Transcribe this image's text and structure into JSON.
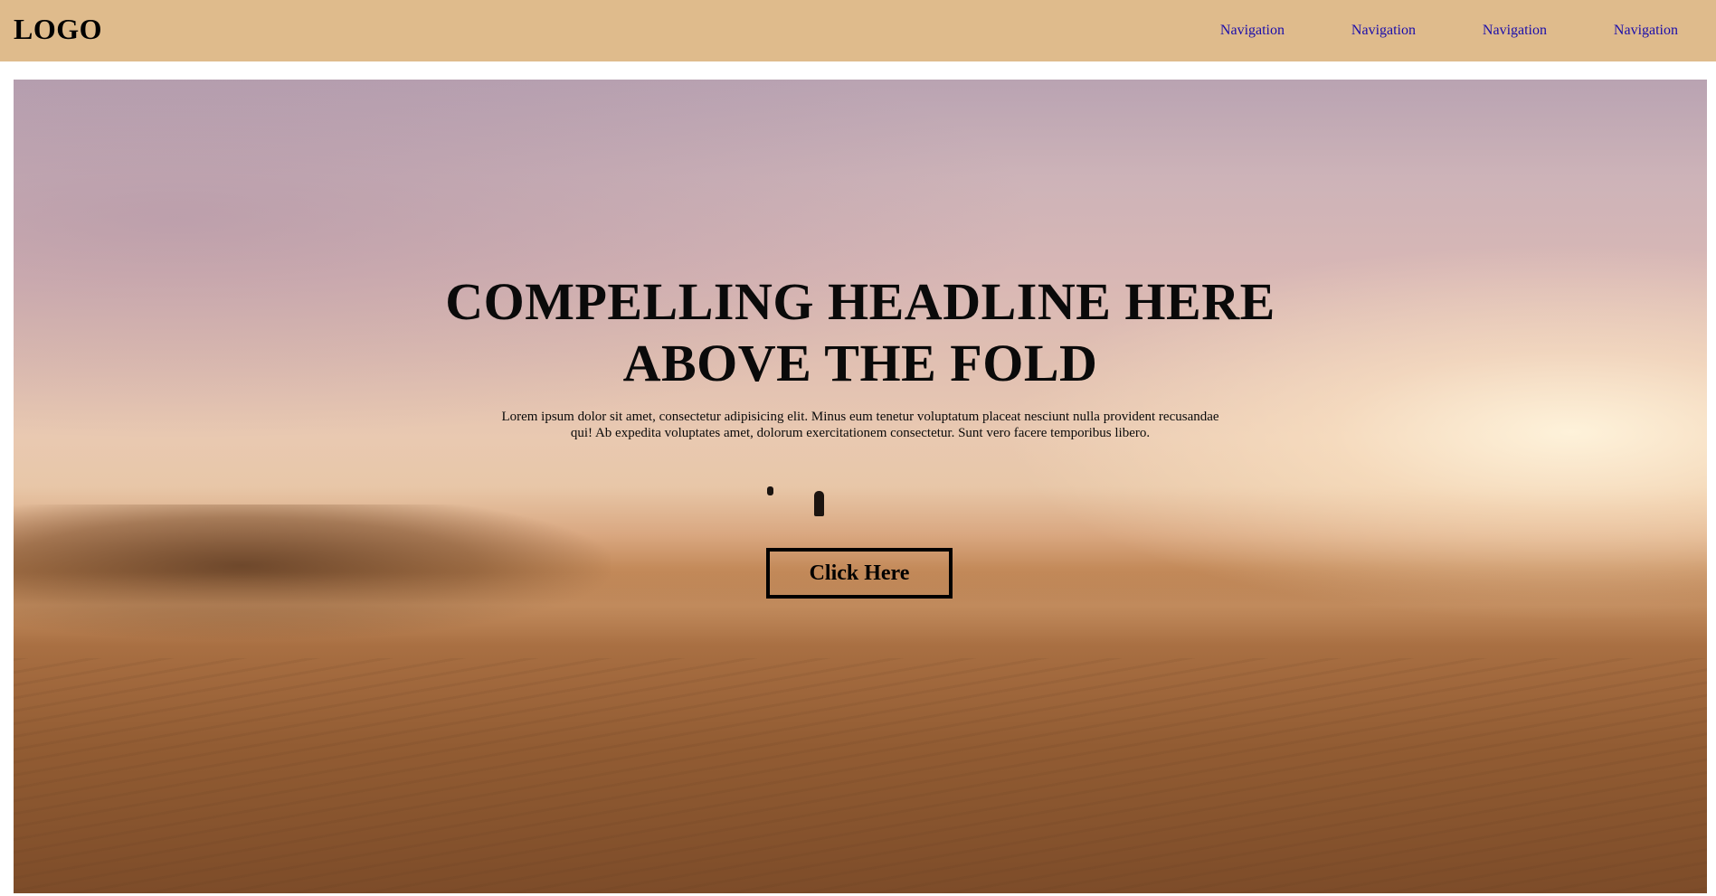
{
  "header": {
    "logo": "LOGO",
    "nav": [
      "Navigation",
      "Navigation",
      "Navigation",
      "Navigation"
    ]
  },
  "hero": {
    "headline": "COMPELLING HEADLINE HERE ABOVE THE FOLD",
    "body": "Lorem ipsum dolor sit amet, consectetur adipisicing elit. Minus eum tenetur voluptatum placeat nesciunt nulla provident recusandae qui! Ab expedita voluptates amet, dolorum exercitationem consectetur. Sunt vero facere temporibus libero.",
    "cta_label": "Click Here"
  },
  "colors": {
    "header_bg": "#dfbb8c",
    "link": "#1a0dab",
    "text": "#0a0a0a"
  }
}
